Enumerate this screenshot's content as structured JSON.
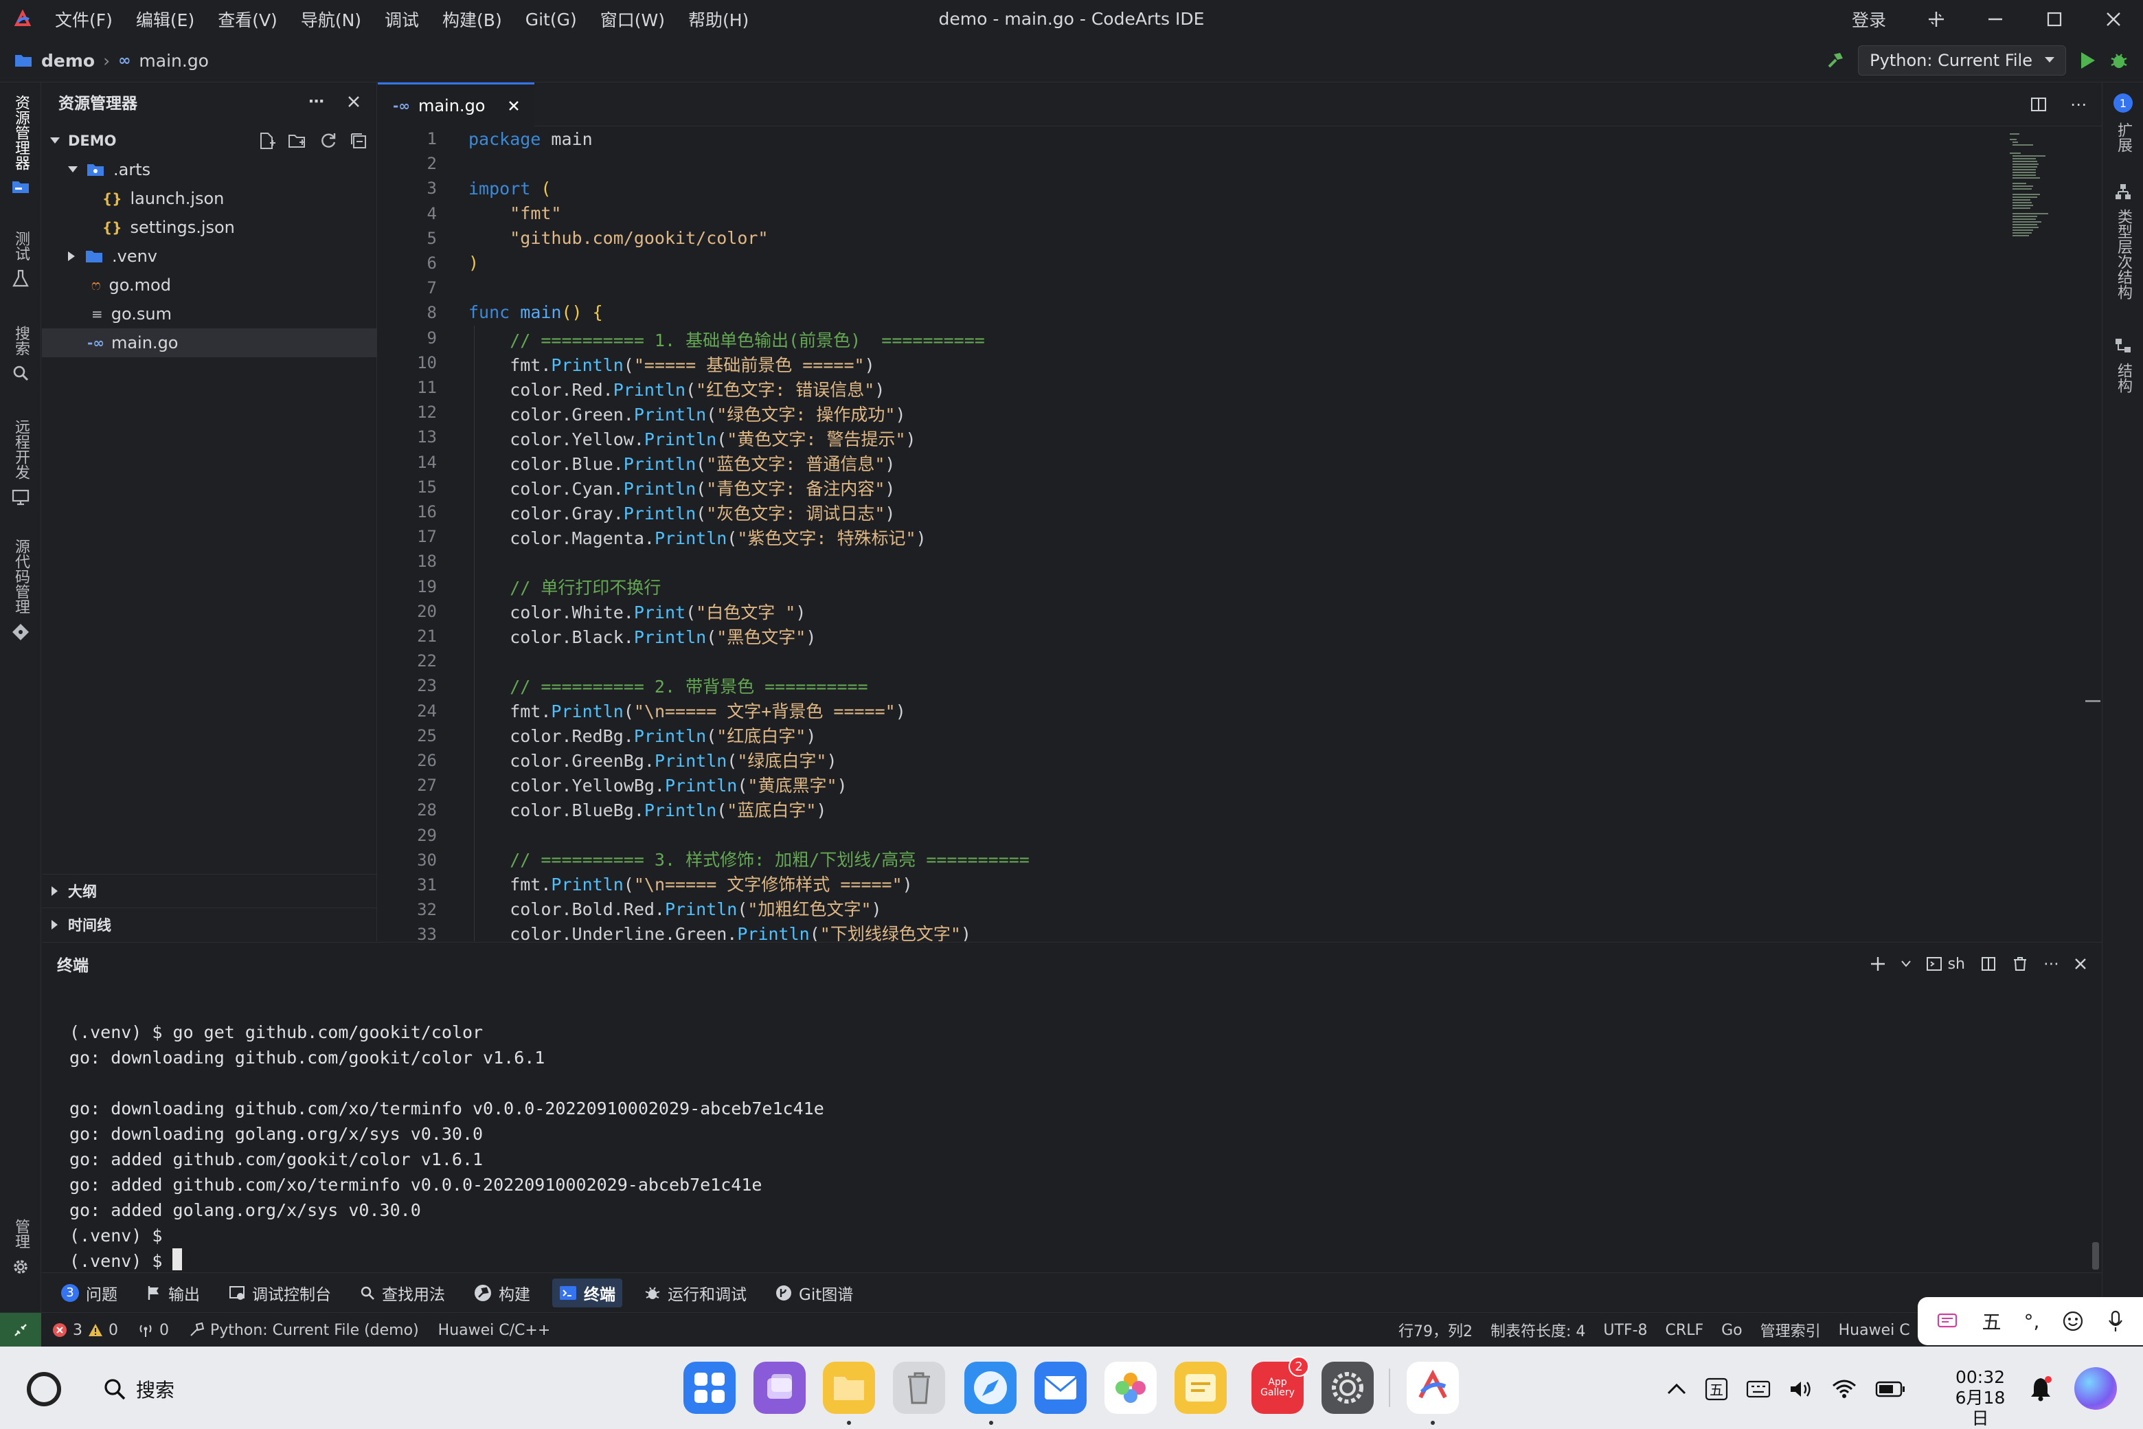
{
  "window": {
    "title": "demo - main.go - CodeArts IDE",
    "menu": [
      "文件(F)",
      "编辑(E)",
      "查看(V)",
      "导航(N)",
      "调试",
      "构建(B)",
      "Git(G)",
      "窗口(W)",
      "帮助(H)"
    ],
    "login": "登录"
  },
  "breadcrumb": {
    "project": "demo",
    "file": "main.go"
  },
  "run": {
    "config": "Python: Current File"
  },
  "left_activity": [
    {
      "label": "资源管理器",
      "icon": "folder-icon"
    },
    {
      "label": "测试",
      "icon": "flask-icon"
    },
    {
      "label": "搜索",
      "icon": "search-icon"
    },
    {
      "label": "远程开发",
      "icon": "remote-icon"
    },
    {
      "label": "源代码管理",
      "icon": "git-icon"
    },
    {
      "label": "管理",
      "icon": "gear-icon"
    }
  ],
  "right_activity": [
    {
      "label": "扩展",
      "icon": "extension-icon"
    },
    {
      "label": "类型层次结构",
      "icon": "hierarchy-icon"
    },
    {
      "label": "结构",
      "icon": "structure-icon"
    }
  ],
  "explorer": {
    "title": "资源管理器",
    "root": "DEMO",
    "tree": [
      {
        "name": ".arts",
        "type": "folder",
        "level": 1,
        "expanded": true
      },
      {
        "name": "launch.json",
        "type": "json",
        "level": 2
      },
      {
        "name": "settings.json",
        "type": "json",
        "level": 2
      },
      {
        "name": ".venv",
        "type": "folder",
        "level": 1,
        "expanded": false
      },
      {
        "name": "go.mod",
        "type": "mod",
        "level": 1
      },
      {
        "name": "go.sum",
        "type": "sum",
        "level": 1
      },
      {
        "name": "main.go",
        "type": "go",
        "level": 1,
        "selected": true
      }
    ],
    "outline": "大纲",
    "timeline": "时间线"
  },
  "editor": {
    "tab": "main.go",
    "line_numbers": [
      "1",
      "2",
      "3",
      "4",
      "5",
      "6",
      "7",
      "8",
      "9",
      "10",
      "11",
      "12",
      "13",
      "14",
      "15",
      "16",
      "17",
      "18",
      "19",
      "20",
      "21",
      "22",
      "23",
      "24",
      "25",
      "26",
      "27",
      "28",
      "29",
      "30",
      "31",
      "32",
      "33"
    ]
  },
  "terminal": {
    "title": "终端",
    "shell": "sh",
    "lines": [
      "(.venv) $ go get github.com/gookit/color",
      "go: downloading github.com/gookit/color v1.6.1",
      "",
      "go: downloading github.com/xo/terminfo v0.0.0-20220910002029-abceb7e1c41e",
      "go: downloading golang.org/x/sys v0.30.0",
      "go: added github.com/gookit/color v1.6.1",
      "go: added github.com/xo/terminfo v0.0.0-20220910002029-abceb7e1c41e",
      "go: added golang.org/x/sys v0.30.0",
      "(.venv) $",
      "(.venv) $"
    ]
  },
  "tool_tabs": [
    {
      "label": "问题",
      "badge": "3",
      "icon": "problems-icon"
    },
    {
      "label": "输出",
      "icon": "output-icon"
    },
    {
      "label": "调试控制台",
      "icon": "debug-console-icon"
    },
    {
      "label": "查找用法",
      "icon": "find-usages-icon"
    },
    {
      "label": "构建",
      "icon": "build-icon"
    },
    {
      "label": "终端",
      "icon": "terminal-icon",
      "active": true
    },
    {
      "label": "运行和调试",
      "icon": "run-debug-icon"
    },
    {
      "label": "Git图谱",
      "icon": "git-graph-icon"
    }
  ],
  "status": {
    "errors": "3",
    "warnings": "0",
    "ports": "0",
    "run_config": "Python: Current File (demo)",
    "plugin": "Huawei C/C++",
    "position": "行79，列2",
    "tab_size": "制表符长度: 4",
    "encoding": "UTF-8",
    "eol": "CRLF",
    "language": "Go",
    "index": "管理索引",
    "huawei": "Huawei C"
  },
  "ime": {
    "mode": "五",
    "punct": "°,"
  },
  "taskbar": {
    "search": "搜索",
    "time": "00:32",
    "date": "6月18日",
    "appgallery_badge": "2",
    "appgallery_label_1": "App",
    "appgallery_label_2": "Gallery"
  },
  "colors": {
    "accent": "#3574f0",
    "comment": "#64a854",
    "string": "#e0b885",
    "keyword": "#3b8ad9"
  }
}
